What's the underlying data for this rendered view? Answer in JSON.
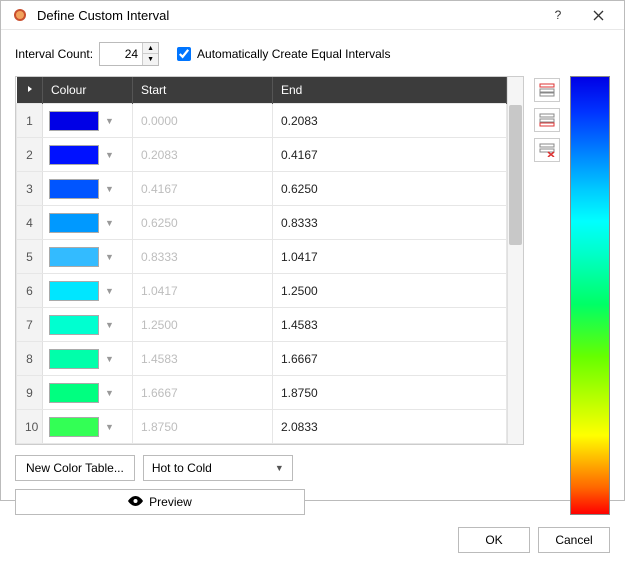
{
  "title": "Define Custom Interval",
  "interval_count_label": "Interval Count:",
  "interval_count_value": "24",
  "auto_intervals_label": "Automatically Create Equal Intervals",
  "auto_intervals_checked": true,
  "table": {
    "headers": {
      "colour": "Colour",
      "start": "Start",
      "end": "End"
    },
    "rows": [
      {
        "index": "1",
        "color": "#0000e6",
        "start": "0.0000",
        "end": "0.2083"
      },
      {
        "index": "2",
        "color": "#0011ff",
        "start": "0.2083",
        "end": "0.4167"
      },
      {
        "index": "3",
        "color": "#0055ff",
        "start": "0.4167",
        "end": "0.6250"
      },
      {
        "index": "4",
        "color": "#0099ff",
        "start": "0.6250",
        "end": "0.8333"
      },
      {
        "index": "5",
        "color": "#33bbff",
        "start": "0.8333",
        "end": "1.0417"
      },
      {
        "index": "6",
        "color": "#00e6ff",
        "start": "1.0417",
        "end": "1.2500"
      },
      {
        "index": "7",
        "color": "#00ffd0",
        "start": "1.2500",
        "end": "1.4583"
      },
      {
        "index": "8",
        "color": "#00ffaa",
        "start": "1.4583",
        "end": "1.6667"
      },
      {
        "index": "9",
        "color": "#00ff80",
        "start": "1.6667",
        "end": "1.8750"
      },
      {
        "index": "10",
        "color": "#33ff55",
        "start": "1.8750",
        "end": "2.0833"
      }
    ]
  },
  "side_buttons": {
    "add_above": "add-interval-above",
    "add_below": "add-interval-below",
    "delete": "delete-interval"
  },
  "new_color_table_label": "New Color Table...",
  "preset_selected": "Hot to Cold",
  "preview_label": "Preview",
  "ok_label": "OK",
  "cancel_label": "Cancel"
}
